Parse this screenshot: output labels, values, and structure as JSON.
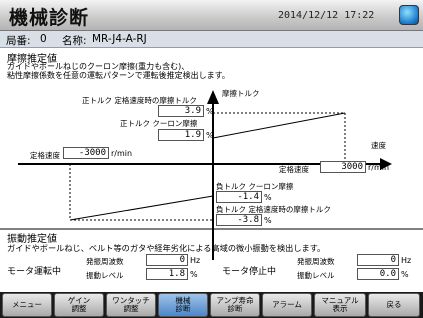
{
  "header": {
    "title": "機械診断",
    "datetime": "2014/12/12  17:22"
  },
  "info": {
    "station_label": "局番:",
    "station_value": "0",
    "name_label": "名称:",
    "name_value": "MR-J4-A-RJ"
  },
  "friction": {
    "heading": "摩擦推定値",
    "description_line1": "ガイドやボールねじのクーロン摩擦(重力も含む)、",
    "description_line2": "粘性摩擦係数を任意の運転パターンで運転後推定検出します。",
    "torque_axis_label": "摩擦トルク",
    "speed_axis_label": "速度",
    "pos_rated_label": "正トルク 定格速度時の摩擦トルク",
    "pos_rated_value": "3.9",
    "pos_coulomb_label": "正トルク クーロン摩擦",
    "pos_coulomb_value": "1.9",
    "neg_coulomb_label": "負トルク クーロン摩擦",
    "neg_coulomb_value": "-1.4",
    "neg_rated_label": "負トルク 定格速度時の摩擦トルク",
    "neg_rated_value": "-3.8",
    "percent_unit": "%",
    "rated_speed_neg_label": "定格速度",
    "rated_speed_neg_value": "-3000",
    "rated_speed_pos_label": "定格速度",
    "rated_speed_pos_value": "3000",
    "speed_unit": "r/min"
  },
  "vibration": {
    "heading": "振動推定値",
    "description": "ガイドやボールねじ、ベルト等のガタや経年劣化による高域の微小振動を検出します。",
    "running_label": "モータ運転中",
    "stopped_label": "モータ停止中",
    "freq_label": "発振周波数",
    "level_label": "振動レベル",
    "run_freq": "0",
    "run_level": "1.8",
    "stop_freq": "0",
    "stop_level": "0.0",
    "hz_unit": "Hz",
    "pct_unit": "%"
  },
  "nav": {
    "menu": "メニュー",
    "gain": "ゲイン\n調整",
    "one_touch": "ワンタッチ\n調整",
    "machine_diag": "機械\n診断",
    "amp_life": "アンプ寿命\n診断",
    "alarm": "アラーム",
    "manual": "マニュアル\n表示",
    "back": "戻る"
  },
  "colors": {
    "active_nav": "#4d86c8",
    "title_bg": "#d0d0d0"
  }
}
